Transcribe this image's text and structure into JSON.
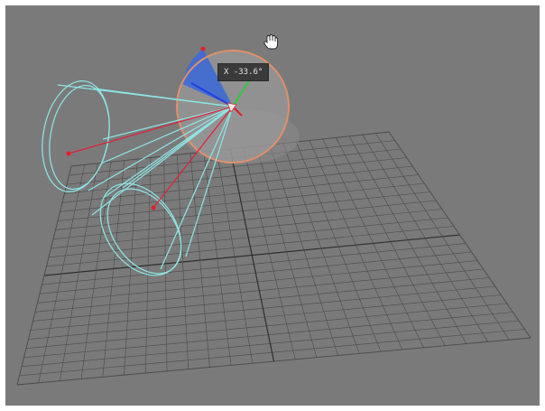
{
  "viewport": {
    "background": "#7a7a7a",
    "grid_color": "#4a4a4a",
    "grid_axis_color": "#2e2e2e",
    "grid_divisions": 24
  },
  "rotate_gizmo": {
    "readout_text": "X -33.6°",
    "angle_deg": -33.6,
    "ring_color": "#e0906a",
    "sphere_color": "#9a9a9a",
    "wedge_color": "#3d6ad6",
    "x_axis_color": "#e0202a",
    "y_axis_color": "#2ec840",
    "z_axis_color": "#2040e0"
  },
  "light_cones": {
    "wire_color": "#8fe6e6",
    "target_line_color": "#e0203a",
    "target_dot_color": "#e0202a",
    "count": 2
  },
  "cursor": {
    "icon": "hand-cursor-icon"
  }
}
